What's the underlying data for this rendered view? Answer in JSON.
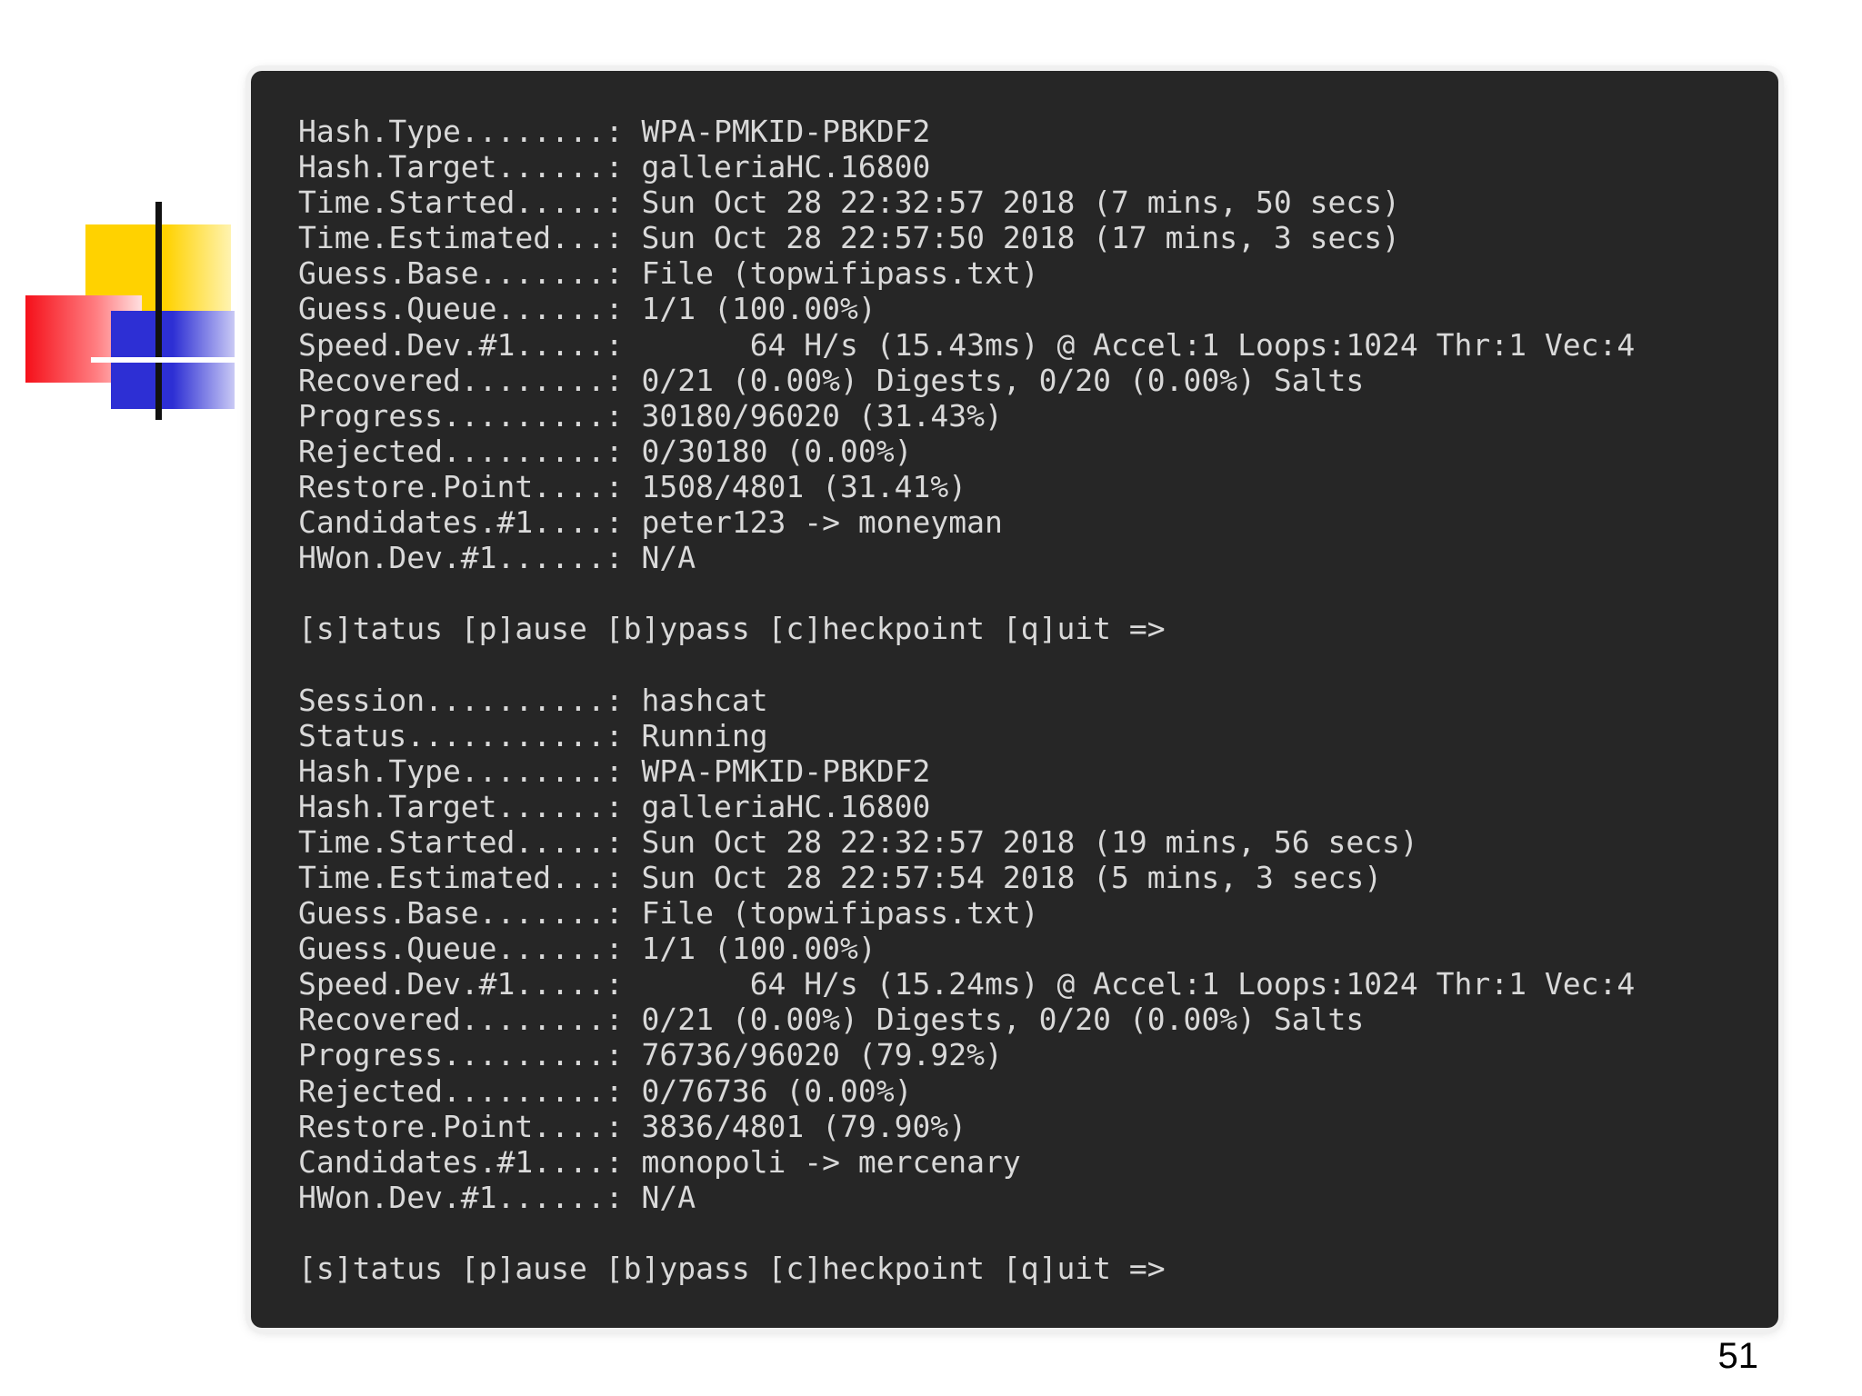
{
  "slide": {
    "page_number": "51"
  },
  "terminal": {
    "blocks": [
      {
        "lines": [
          "Hash.Type........: WPA-PMKID-PBKDF2",
          "Hash.Target......: galleriaHC.16800",
          "Time.Started.....: Sun Oct 28 22:32:57 2018 (7 mins, 50 secs)",
          "Time.Estimated...: Sun Oct 28 22:57:50 2018 (17 mins, 3 secs)",
          "Guess.Base.......: File (topwifipass.txt)",
          "Guess.Queue......: 1/1 (100.00%)",
          "Speed.Dev.#1.....:       64 H/s (15.43ms) @ Accel:1 Loops:1024 Thr:1 Vec:4",
          "Recovered........: 0/21 (0.00%) Digests, 0/20 (0.00%) Salts",
          "Progress.........: 30180/96020 (31.43%)",
          "Rejected.........: 0/30180 (0.00%)",
          "Restore.Point....: 1508/4801 (31.41%)",
          "Candidates.#1....: peter123 -> moneyman",
          "HWon.Dev.#1......: N/A"
        ],
        "prompt": "[s]tatus [p]ause [b]ypass [c]heckpoint [q]uit =>"
      },
      {
        "lines": [
          "Session..........: hashcat",
          "Status...........: Running",
          "Hash.Type........: WPA-PMKID-PBKDF2",
          "Hash.Target......: galleriaHC.16800",
          "Time.Started.....: Sun Oct 28 22:32:57 2018 (19 mins, 56 secs)",
          "Time.Estimated...: Sun Oct 28 22:57:54 2018 (5 mins, 3 secs)",
          "Guess.Base.......: File (topwifipass.txt)",
          "Guess.Queue......: 1/1 (100.00%)",
          "Speed.Dev.#1.....:       64 H/s (15.24ms) @ Accel:1 Loops:1024 Thr:1 Vec:4",
          "Recovered........: 0/21 (0.00%) Digests, 0/20 (0.00%) Salts",
          "Progress.........: 76736/96020 (79.92%)",
          "Rejected.........: 0/76736 (0.00%)",
          "Restore.Point....: 3836/4801 (79.90%)",
          "Candidates.#1....: monopoli -> mercenary",
          "HWon.Dev.#1......: N/A"
        ],
        "prompt": "[s]tatus [p]ause [b]ypass [c]heckpoint [q]uit =>"
      }
    ]
  }
}
